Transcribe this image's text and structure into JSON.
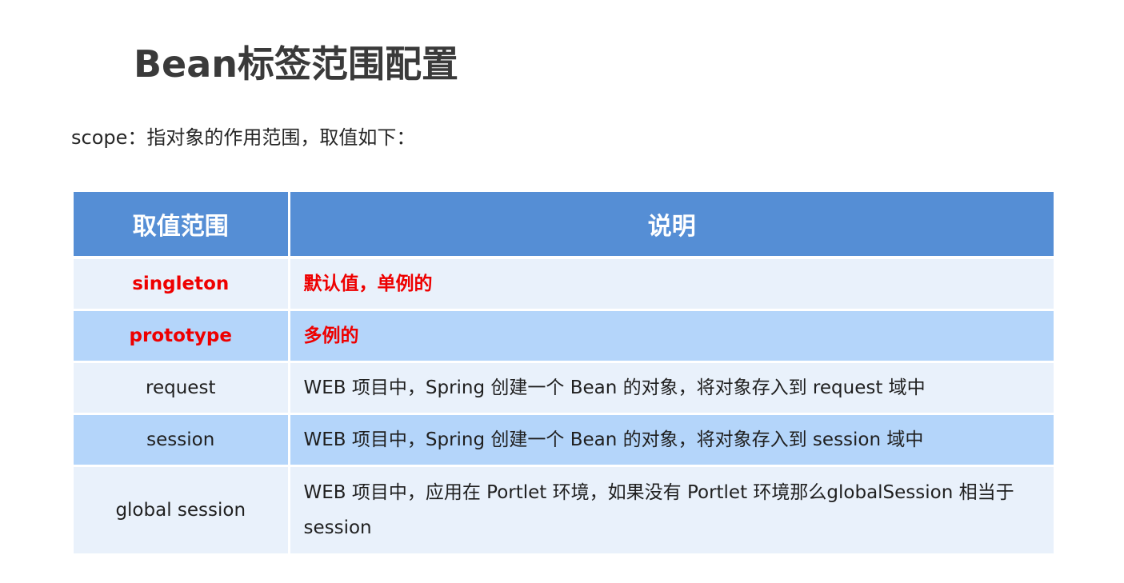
{
  "title": "Bean标签范围配置",
  "subtitle": "scope：指对象的作用范围，取值如下：",
  "table": {
    "headers": [
      "取值范围",
      "说明"
    ],
    "rows": [
      {
        "name": "singleton",
        "desc": "默认值，单例的"
      },
      {
        "name": "prototype",
        "desc": "多例的"
      },
      {
        "name": "request",
        "desc": "WEB 项目中，Spring 创建一个 Bean 的对象，将对象存入到 request 域中"
      },
      {
        "name": "session",
        "desc": "WEB 项目中，Spring 创建一个 Bean 的对象，将对象存入到 session 域中"
      },
      {
        "name": "global session",
        "desc": "WEB 项目中，应用在 Portlet 环境，如果没有 Portlet 环境那么globalSession 相当于 session"
      }
    ]
  },
  "colors": {
    "header_bg": "#558ed5",
    "row_light": "#e9f1fb",
    "row_dark": "#b4d5fa",
    "highlight_text": "#ee0000"
  }
}
